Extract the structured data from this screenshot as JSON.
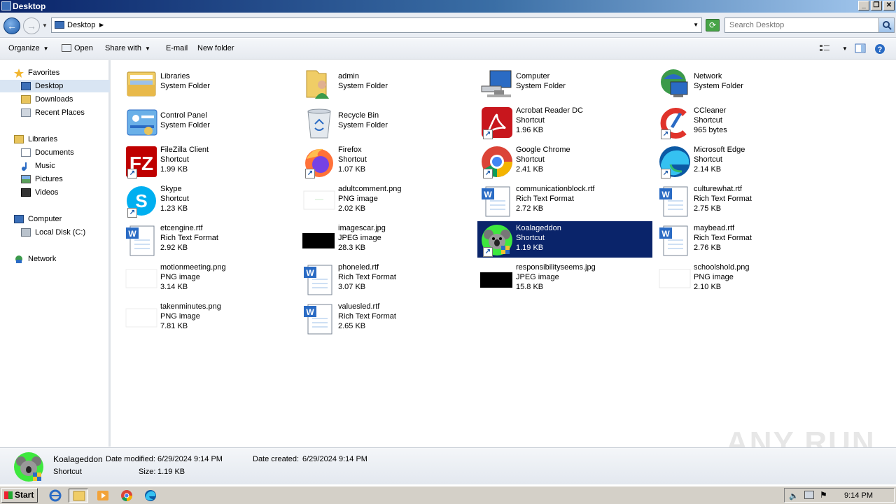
{
  "window": {
    "title": "Desktop"
  },
  "address": {
    "crumb": "Desktop",
    "search_placeholder": "Search Desktop"
  },
  "toolbar": {
    "organize": "Organize",
    "open": "Open",
    "share_with": "Share with",
    "email": "E-mail",
    "new_folder": "New folder"
  },
  "nav": {
    "favorites": "Favorites",
    "desktop": "Desktop",
    "downloads": "Downloads",
    "recent_places": "Recent Places",
    "libraries": "Libraries",
    "documents": "Documents",
    "music": "Music",
    "pictures": "Pictures",
    "videos": "Videos",
    "computer": "Computer",
    "local_disk": "Local Disk (C:)",
    "network": "Network"
  },
  "items": [
    {
      "name": "Libraries",
      "type": "System Folder",
      "size": ""
    },
    {
      "name": "admin",
      "type": "System Folder",
      "size": ""
    },
    {
      "name": "Computer",
      "type": "System Folder",
      "size": ""
    },
    {
      "name": "Network",
      "type": "System Folder",
      "size": ""
    },
    {
      "name": "Control Panel",
      "type": "System Folder",
      "size": ""
    },
    {
      "name": "Recycle Bin",
      "type": "System Folder",
      "size": ""
    },
    {
      "name": "Acrobat Reader DC",
      "type": "Shortcut",
      "size": "1.96 KB"
    },
    {
      "name": "CCleaner",
      "type": "Shortcut",
      "size": "965 bytes"
    },
    {
      "name": "FileZilla Client",
      "type": "Shortcut",
      "size": "1.99 KB"
    },
    {
      "name": "Firefox",
      "type": "Shortcut",
      "size": "1.07 KB"
    },
    {
      "name": "Google Chrome",
      "type": "Shortcut",
      "size": "2.41 KB"
    },
    {
      "name": "Microsoft Edge",
      "type": "Shortcut",
      "size": "2.14 KB"
    },
    {
      "name": "Skype",
      "type": "Shortcut",
      "size": "1.23 KB"
    },
    {
      "name": "adultcomment.png",
      "type": "PNG image",
      "size": "2.02 KB"
    },
    {
      "name": "communicationblock.rtf",
      "type": "Rich Text Format",
      "size": "2.72 KB"
    },
    {
      "name": "culturewhat.rtf",
      "type": "Rich Text Format",
      "size": "2.75 KB"
    },
    {
      "name": "etcengine.rtf",
      "type": "Rich Text Format",
      "size": "2.92 KB"
    },
    {
      "name": "imagescar.jpg",
      "type": "JPEG image",
      "size": "28.3 KB"
    },
    {
      "name": "Koalageddon",
      "type": "Shortcut",
      "size": "1.19 KB"
    },
    {
      "name": "maybead.rtf",
      "type": "Rich Text Format",
      "size": "2.76 KB"
    },
    {
      "name": "motionmeeting.png",
      "type": "PNG image",
      "size": "3.14 KB"
    },
    {
      "name": "phoneled.rtf",
      "type": "Rich Text Format",
      "size": "3.07 KB"
    },
    {
      "name": "responsibilityseems.jpg",
      "type": "JPEG image",
      "size": "15.8 KB"
    },
    {
      "name": "schoolshold.png",
      "type": "PNG image",
      "size": "2.10 KB"
    },
    {
      "name": "takenminutes.png",
      "type": "PNG image",
      "size": "7.81 KB"
    },
    {
      "name": "valuesled.rtf",
      "type": "Rich Text Format",
      "size": "2.65 KB"
    }
  ],
  "details": {
    "name": "Koalageddon",
    "type": "Shortcut",
    "date_modified_label": "Date modified:",
    "date_modified": "6/29/2024 9:14 PM",
    "date_created_label": "Date created:",
    "date_created": "6/29/2024 9:14 PM",
    "size_label": "Size:",
    "size": "1.19 KB"
  },
  "taskbar": {
    "start": "Start",
    "clock": "9:14 PM"
  },
  "watermark": "ANY RUN"
}
